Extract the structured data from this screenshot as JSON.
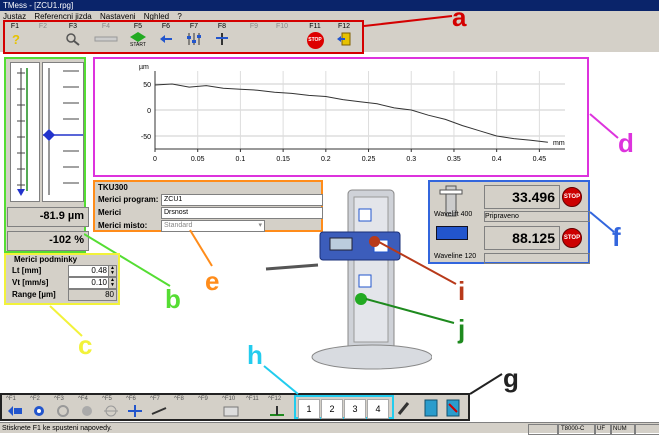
{
  "window": {
    "title": "TMess - [ZCU1.rpg]"
  },
  "menu": {
    "items": [
      "Justaz",
      "Referencni jizda",
      "Nastaveni",
      "Nghled",
      "?"
    ]
  },
  "top_toolbar": {
    "keys": [
      "F1",
      "F2",
      "F3",
      "F4",
      "F5",
      "F6",
      "F7",
      "F8",
      "F9",
      "F10",
      "F11",
      "F12"
    ],
    "start_label": "START",
    "stop_label": "STOP"
  },
  "annotations": {
    "a": "a",
    "b": "b",
    "c": "c",
    "d": "d",
    "e": "e",
    "f": "f",
    "g": "g",
    "h": "h",
    "i": "i",
    "j": "j"
  },
  "annotation_colors": {
    "a": "#d40000",
    "b": "#55dd33",
    "c": "#f2f23a",
    "d": "#dd33dd",
    "e": "#ff8c1a",
    "f": "#3366dd",
    "g": "#222222",
    "h": "#22ccee",
    "i": "#b83a1a",
    "j": "#1e8a1e"
  },
  "gauges": {
    "value_um": "-81.9 µm",
    "value_pct": "-102 %"
  },
  "conditions": {
    "title": "Merici podminky",
    "lt_label": "Lt [mm]",
    "lt_value": "0.48",
    "vt_label": "Vt [mm/s]",
    "vt_value": "0.10",
    "range_label": "Range [µm]",
    "range_value": "80"
  },
  "chart_data": {
    "type": "line",
    "ylabel": "µm",
    "xlabel": "mm",
    "x_ticks": [
      "0",
      "0.05",
      "0.1",
      "0.15",
      "0.2",
      "0.25",
      "0.3",
      "0.35",
      "0.4",
      "0.45"
    ],
    "y_ticks": [
      "50",
      "0",
      "-50"
    ],
    "xlim": [
      0,
      0.48
    ],
    "ylim": [
      -75,
      75
    ],
    "grid": true,
    "series": [
      {
        "x": [
          0,
          0.02,
          0.04,
          0.06,
          0.08,
          0.1,
          0.12,
          0.14,
          0.16,
          0.18,
          0.2,
          0.22,
          0.24,
          0.26,
          0.28,
          0.3,
          0.32,
          0.34,
          0.36,
          0.38,
          0.4,
          0.42,
          0.44,
          0.46
        ],
        "y": [
          48,
          50,
          44,
          47,
          42,
          40,
          38,
          34,
          32,
          28,
          26,
          20,
          16,
          12,
          4,
          0,
          -10,
          -18,
          -30,
          -40,
          -50,
          -55,
          -58,
          -62
        ]
      }
    ]
  },
  "info": {
    "device": "TKU300",
    "program_label": "Merici program:",
    "program_value": "ZCU1",
    "operator_label": "Merici",
    "operator_value": "Drsnost",
    "place_label": "Merici misto:",
    "place_value": "Standard"
  },
  "devices": {
    "d1_value": "33.496",
    "d1_name": "Wavelift 400",
    "d1_status": "Pripraveno",
    "d2_value": "88.125",
    "d2_name": "Waveline 120",
    "stop": "STOP"
  },
  "bottom_toolbar": {
    "keys": [
      "^F1",
      "^F2",
      "^F3",
      "^F4",
      "^F5",
      "^F6",
      "^F7",
      "^F8",
      "^F9",
      "^F10",
      "^F11",
      "^F12"
    ],
    "segments": [
      "1",
      "2",
      "3",
      "4"
    ]
  },
  "status": {
    "hint": "Stisknete F1 ke spusteni napovedy.",
    "model": "T8000-C",
    "uf": "UF",
    "num": "NUM"
  }
}
